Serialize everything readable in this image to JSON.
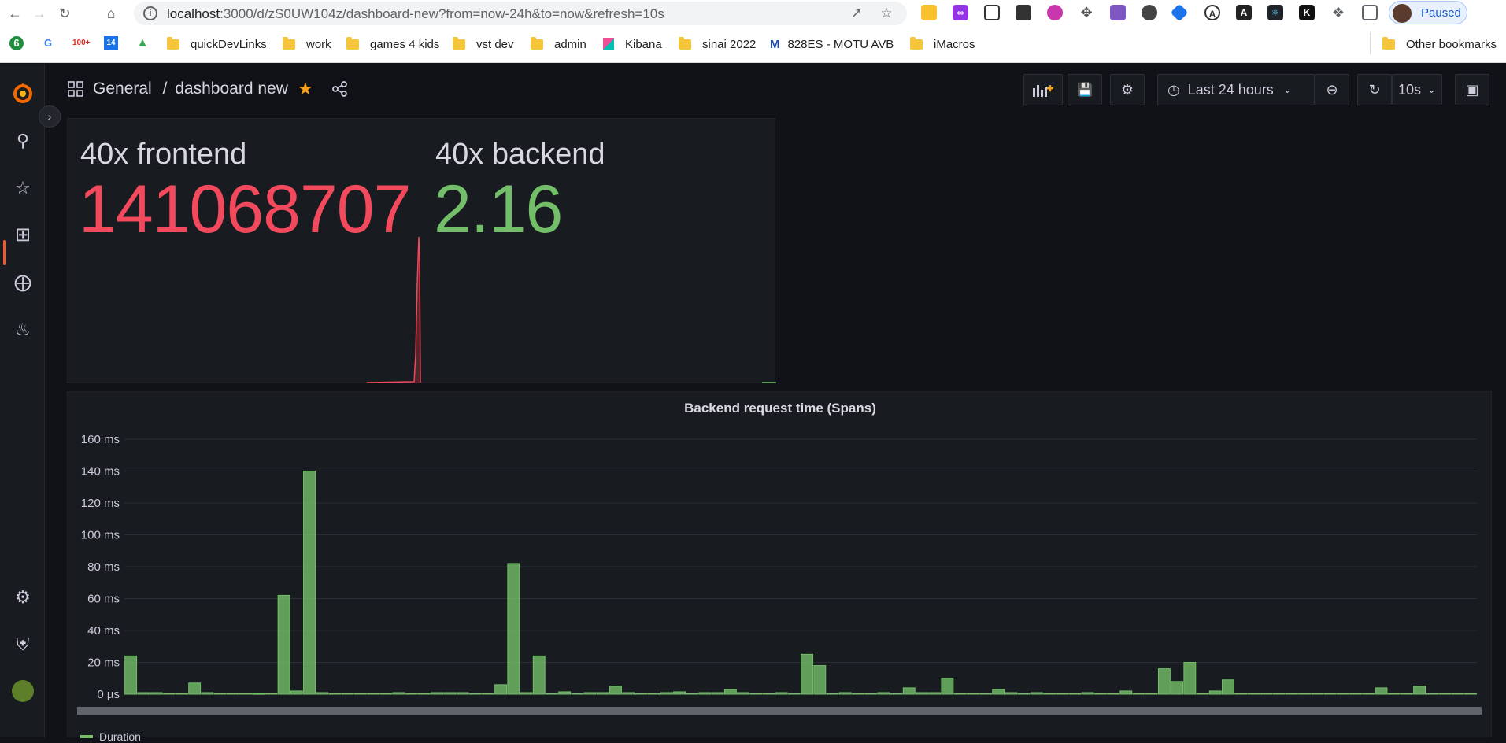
{
  "browser": {
    "url_host": "localhost",
    "url_path": ":3000/d/zS0UW104z/dashboard-new?from=now-24h&to=now&refresh=10s",
    "profile_label": "Paused",
    "bookmarks": [
      {
        "label": "quickDevLinks",
        "type": "folder"
      },
      {
        "label": "work",
        "type": "folder"
      },
      {
        "label": "games 4 kids",
        "type": "folder"
      },
      {
        "label": "vst dev",
        "type": "folder"
      },
      {
        "label": "admin",
        "type": "folder"
      },
      {
        "label": "Kibana",
        "type": "link",
        "icon": "kibana-icon"
      },
      {
        "label": "sinai 2022",
        "type": "folder"
      },
      {
        "label": "828ES - MOTU AVB",
        "type": "link",
        "icon": "motu-icon"
      },
      {
        "label": "iMacros",
        "type": "folder"
      }
    ],
    "other_bookmarks": "Other bookmarks",
    "quick_icons": [
      "6",
      "G",
      "100+",
      "14"
    ]
  },
  "dashboard": {
    "folder": "General",
    "separator": "/",
    "title": "dashboard new",
    "time_range": "Last 24 hours",
    "refresh": "10s"
  },
  "stat_panel": {
    "frontend": {
      "title": "40x frontend",
      "value": "141068707",
      "color": "#f2495c"
    },
    "backend": {
      "title": "40x backend",
      "value": "2.16",
      "color": "#73bf69"
    }
  },
  "chart_data": {
    "type": "bar",
    "title": "Backend request time (Spans)",
    "ylabel": "",
    "y_ticks": [
      "0 µs",
      "20 ms",
      "40 ms",
      "60 ms",
      "80 ms",
      "100 ms",
      "120 ms",
      "140 ms",
      "160 ms"
    ],
    "ylim": [
      0,
      160
    ],
    "unit": "ms",
    "series": [
      {
        "name": "Duration",
        "color": "#73bf69",
        "values": [
          24,
          1,
          1,
          0.5,
          0.5,
          7,
          1,
          0.5,
          0.5,
          0.5,
          0.3,
          0.5,
          62,
          2,
          140,
          1,
          0.5,
          0.5,
          0.5,
          0.5,
          0.5,
          1,
          0.5,
          0.5,
          1,
          1,
          1,
          0.5,
          0.5,
          6,
          82,
          1,
          24,
          0.5,
          1.5,
          0.5,
          1,
          1,
          5,
          1,
          0.5,
          0.5,
          1,
          1.5,
          0.5,
          1,
          1,
          3,
          1,
          0.5,
          0.5,
          1,
          0.5,
          25,
          18,
          0.5,
          1,
          0.5,
          0.5,
          1,
          0.5,
          4,
          1,
          1,
          10,
          0.5,
          0.5,
          0.5,
          3,
          1,
          0.5,
          1,
          0.5,
          0.5,
          0.5,
          1,
          0.5,
          0.5,
          2,
          0.5,
          0.5,
          16,
          8,
          20,
          0.5,
          2,
          9,
          0.5,
          0.5,
          0.5,
          0.5,
          0.5,
          0.5,
          0.5,
          0.5,
          0.5,
          0.5,
          0.5,
          4,
          0.5,
          0.5,
          5,
          0.5,
          0.5,
          0.5,
          0.5
        ]
      }
    ],
    "legend": [
      "Duration"
    ]
  }
}
